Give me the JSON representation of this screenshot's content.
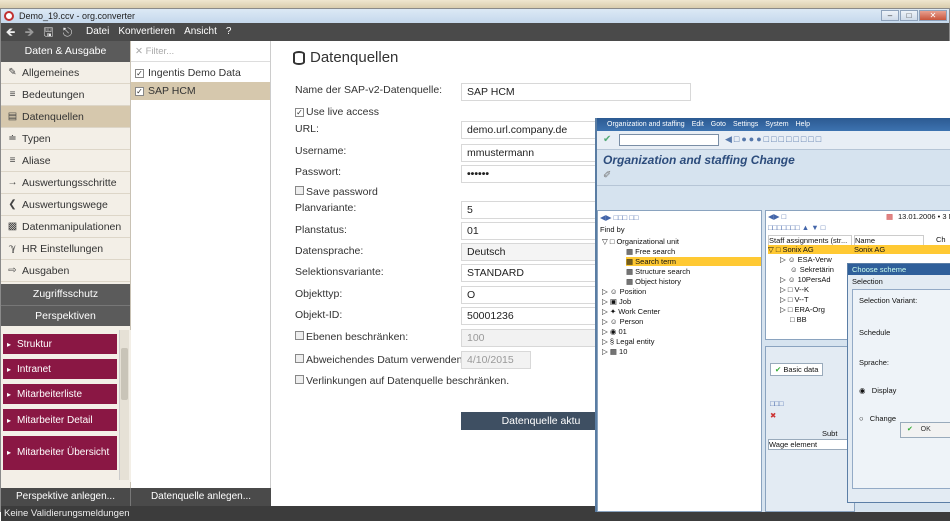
{
  "window": {
    "title": "Demo_19.ccv - org.converter"
  },
  "menu": {
    "items": [
      "Datei",
      "Konvertieren",
      "Ansicht",
      "?"
    ]
  },
  "nav": {
    "header": "Daten & Ausgabe",
    "items": [
      {
        "label": "Allgemeines",
        "icon": "pencil-icon"
      },
      {
        "label": "Bedeutungen",
        "icon": "glossary-icon"
      },
      {
        "label": "Datenquellen",
        "icon": "database-icon"
      },
      {
        "label": "Typen",
        "icon": "types-icon"
      },
      {
        "label": "Aliase",
        "icon": "alias-icon"
      },
      {
        "label": "Auswertungsschritte",
        "icon": "steps-icon"
      },
      {
        "label": "Auswertungswege",
        "icon": "share-icon"
      },
      {
        "label": "Datenmanipulationen",
        "icon": "manipulation-icon"
      },
      {
        "label": "HR Einstellungen",
        "icon": "hr-icon"
      },
      {
        "label": "Ausgaben",
        "icon": "output-icon"
      }
    ],
    "access_header": "Zugriffsschutz",
    "persp_header": "Perspektiven",
    "perspectives": [
      "Struktur",
      "Intranet",
      "Mitarbeiterliste",
      "Mitarbeiter Detail",
      "Mitarbeiter Übersicht"
    ]
  },
  "sources": {
    "filter_placeholder": "Filter...",
    "items": [
      {
        "label": "Ingentis Demo Data",
        "checked": true
      },
      {
        "label": "SAP HCM",
        "checked": true
      }
    ]
  },
  "buttons": {
    "add_perspective": "Perspektive anlegen...",
    "add_source": "Datenquelle anlegen..."
  },
  "status": "Keine Validierungsmeldungen",
  "form": {
    "title": "Datenquellen",
    "name_label": "Name der SAP-v2-Datenquelle:",
    "name_value": "SAP HCM",
    "live_label": "Use live access",
    "url_label": "URL:",
    "url_value": "demo.url.company.de",
    "user_label": "Username:",
    "user_value": "mmustermann",
    "pass_label": "Passwort:",
    "pass_value": "••••••",
    "save_pass_label": "Save password",
    "plan_label": "Planvariante:",
    "plan_value": "5",
    "status_label": "Planstatus:",
    "status_value": "01",
    "lang_label": "Datensprache:",
    "lang_value": "Deutsch",
    "selvar_label": "Selektionsvariante:",
    "selvar_value": "STANDARD",
    "objtype_label": "Objekttyp:",
    "objtype_value": "O",
    "objid_label": "Objekt-ID:",
    "objid_value": "50001236",
    "levels_label": "Ebenen beschränken:",
    "levels_value": "100",
    "date_label": "Abweichendes Datum verwenden:",
    "date_value": "4/10/2015",
    "links_label": "Verlinkungen auf Datenquelle beschränken.",
    "save_button": "Datenquelle aktu"
  },
  "sap": {
    "menu": [
      "Organization and staffing",
      "Edit",
      "Goto",
      "Settings",
      "System",
      "Help"
    ],
    "title": "Organization and staffing Change",
    "findby": "Find by",
    "tree": [
      "Organizational unit",
      "Free search",
      "Search term",
      "Structure search",
      "Object history",
      "Position",
      "Job",
      "Work Center",
      "Person",
      "01",
      "Legal entity",
      "10"
    ],
    "date": "13.01.2006 • 3 M",
    "staff_header": "Staff assignments (str...",
    "name_header": "Name",
    "ch_header": "Ch",
    "org_rows": [
      "Sonix AG",
      "ESA-Verw",
      "Sekretärin",
      "10PersAd",
      "V--K",
      "V--T",
      "ERA-Org",
      "BB"
    ],
    "name_value": "Sonix AG",
    "basic_tab": "Basic data",
    "subt": "Subt",
    "wage": "Wage element",
    "dialog": {
      "title": "Choose scheme",
      "tab": "Selection",
      "selvar": "Selection Variant:",
      "schedule": "Schedule",
      "sprache": "Sprache:",
      "display": "Display",
      "change": "Change",
      "ok": "OK"
    }
  }
}
